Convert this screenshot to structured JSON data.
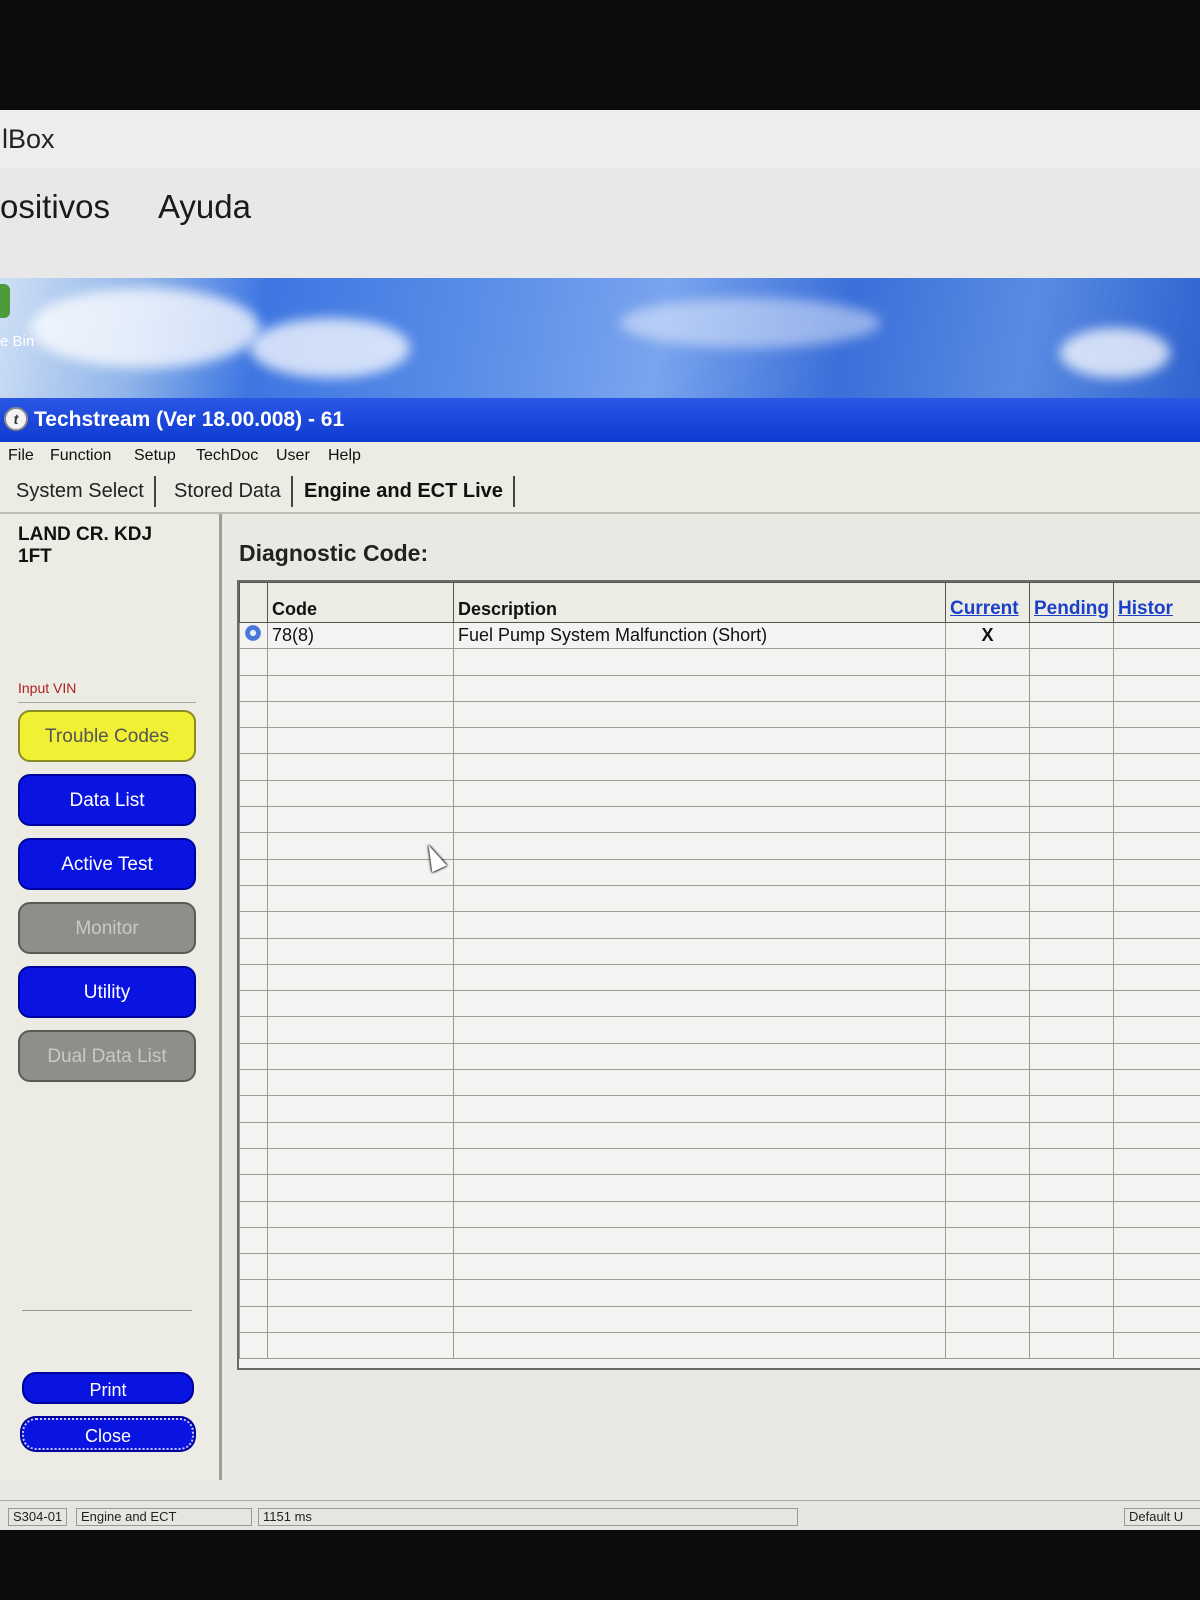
{
  "vbox": {
    "title": "lBox",
    "menu": [
      "ositivos",
      "Ayuda"
    ]
  },
  "desktop": {
    "recycle_label": "e Bin"
  },
  "window": {
    "title": "Techstream (Ver 18.00.008) - 61"
  },
  "menubar": [
    "File",
    "Function",
    "Setup",
    "TechDoc",
    "User",
    "Help"
  ],
  "tabs": [
    "System Select",
    "Stored Data",
    "Engine and ECT Live"
  ],
  "sidebar": {
    "vehicle_line1": "LAND CR. KDJ",
    "vehicle_line2": "1FT",
    "input_vin": "Input VIN",
    "buttons": [
      {
        "label": "Trouble Codes",
        "state": "selected",
        "color": "#f0f034"
      },
      {
        "label": "Data List",
        "state": "enabled",
        "color": "#0a14e0"
      },
      {
        "label": "Active Test",
        "state": "enabled",
        "color": "#0a14e0"
      },
      {
        "label": "Monitor",
        "state": "disabled",
        "color": "#8e8f8b"
      },
      {
        "label": "Utility",
        "state": "enabled",
        "color": "#0a14e0"
      },
      {
        "label": "Dual Data List",
        "state": "disabled",
        "color": "#8e8f8b"
      }
    ],
    "print": "Print",
    "close": "Close"
  },
  "main": {
    "title": "Diagnostic Code:",
    "columns": [
      "",
      "Code",
      "Description",
      "Current",
      "Pending",
      "Histor"
    ],
    "rows": [
      {
        "icon": "gear-icon",
        "code": "78(8)",
        "description": "Fuel Pump System Malfunction (Short)",
        "current": "X",
        "pending": "",
        "history": ""
      }
    ],
    "mil_icon": "engine-eraser-icon"
  },
  "statusbar": {
    "code": "S304-01",
    "system": "Engine and ECT",
    "timing": "1151 ms",
    "right": "Default U"
  }
}
